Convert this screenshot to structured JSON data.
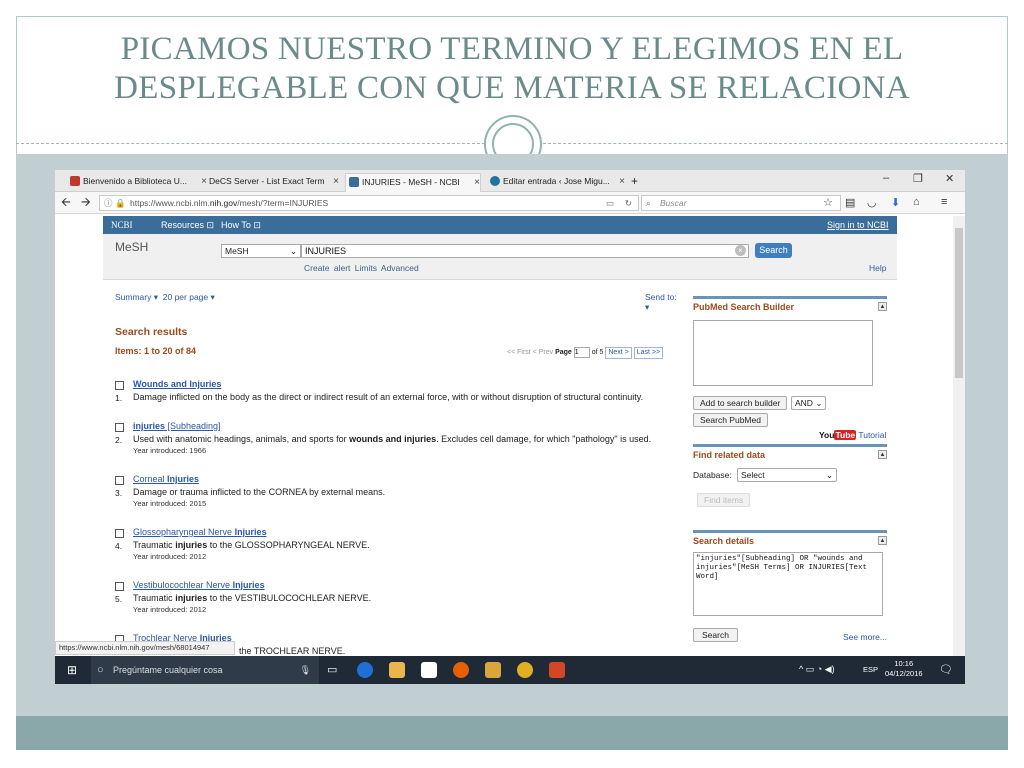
{
  "slide": {
    "title_line1": "PICAMOS NUESTRO TERMINO Y ELEGIMOS EN EL",
    "title_line2": "DESPLEGABLE CON QUE MATERIA SE RELACIONA"
  },
  "browser": {
    "tabs": [
      {
        "label": "Bienvenido a Biblioteca U...",
        "icon": "library-icon",
        "color": "#c0392b"
      },
      {
        "label": "DeCS Server - List Exact Term",
        "icon": "",
        "color": ""
      },
      {
        "label": "INJURIES - MeSH - NCBI",
        "icon": "ncbi-icon",
        "color": "#3a6d9a",
        "active": true
      },
      {
        "label": "Editar entrada ‹ Jose Migu...",
        "icon": "wordpress-icon",
        "color": "#21759b"
      }
    ],
    "new_tab": "+",
    "window_controls": [
      "–",
      "❐",
      "✕"
    ],
    "url_prefix": "https://www.ncbi.nlm.",
    "url_host": "nih.gov",
    "url_path": "/mesh/?term=INJURIES",
    "search_placeholder": "Buscar",
    "status_url": "https://www.ncbi.nlm.nih.gov/mesh/68014947"
  },
  "ncbi": {
    "logo": "NCBI",
    "resources": "Resources",
    "howto": "How To",
    "signin": "Sign in to NCBI",
    "db_title": "MeSH",
    "db_select": "MeSH",
    "query": "INJURIES",
    "search_label": "Search",
    "create_alert": "Create alert",
    "limits": "Limits",
    "advanced": "Advanced",
    "help": "Help"
  },
  "results": {
    "summary": "Summary",
    "per_page": "20 per page",
    "send_to": "Send to:",
    "heading": "Search results",
    "items": "Items: 1 to 20 of 84",
    "first": "<< First",
    "prev": "< Prev",
    "page_label": "Page",
    "page_value": "1",
    "of_pages": "of 5",
    "next": "Next >",
    "last": "Last >>",
    "list": [
      {
        "num": "1.",
        "title_pre": "",
        "title_bold": "Wounds and Injuries",
        "desc_pre": "Damage inflicted on the body as the direct or indirect result of an external force, with or without disruption of structural continuity.",
        "desc_bold": "",
        "desc_post": "",
        "year": ""
      },
      {
        "num": "2.",
        "title_pre": "",
        "title_bold": "injuries",
        "title_post": " [Subheading]",
        "desc_pre": "Used with anatomic headings, animals, and sports for ",
        "desc_bold": "wounds and injuries",
        "desc_post": ". Excludes cell damage, for which \"pathology\" is used.",
        "year": "Year introduced: 1966"
      },
      {
        "num": "3.",
        "title_pre": "Corneal ",
        "title_bold": "Injuries",
        "desc_pre": "Damage or trauma inflicted to the CORNEA by external means.",
        "desc_bold": "",
        "desc_post": "",
        "year": "Year introduced: 2015"
      },
      {
        "num": "4.",
        "title_pre": "Glossopharyngeal Nerve ",
        "title_bold": "Injuries",
        "desc_pre": "Traumatic ",
        "desc_bold": "injuries",
        "desc_post": " to the GLOSSOPHARYNGEAL NERVE.",
        "year": "Year introduced: 2012"
      },
      {
        "num": "5.",
        "title_pre": "Vestibulocochlear Nerve ",
        "title_bold": "Injuries",
        "desc_pre": "Traumatic ",
        "desc_bold": "injuries",
        "desc_post": " to the VESTIBULOCOCHLEAR NERVE.",
        "year": "Year introduced: 2012"
      },
      {
        "num": "6.",
        "title_pre": "Trochlear Nerve ",
        "title_bold": "Injuries",
        "desc_pre": "",
        "desc_bold": "",
        "desc_post": "the TROCHLEAR NERVE.",
        "year": ""
      }
    ]
  },
  "sidebar": {
    "builder_title": "PubMed Search Builder",
    "add_builder": "Add to search builder",
    "and_op": "AND",
    "search_pubmed": "Search PubMed",
    "you": "You",
    "tube": "Tube",
    "tutorial": "Tutorial",
    "related_title": "Find related data",
    "database_label": "Database:",
    "database_value": "Select",
    "find_items": "Find items",
    "details_title": "Search details",
    "details_text": "\"injuries\"[Subheading] OR \"wounds and injuries\"[MeSH Terms] OR INJURIES[Text Word]",
    "details_search": "Search",
    "see_more": "See more..."
  },
  "taskbar": {
    "cortana": "Pregúntame cualquier cosa",
    "lang": "ESP",
    "time": "10:16",
    "date": "04/12/2016"
  }
}
